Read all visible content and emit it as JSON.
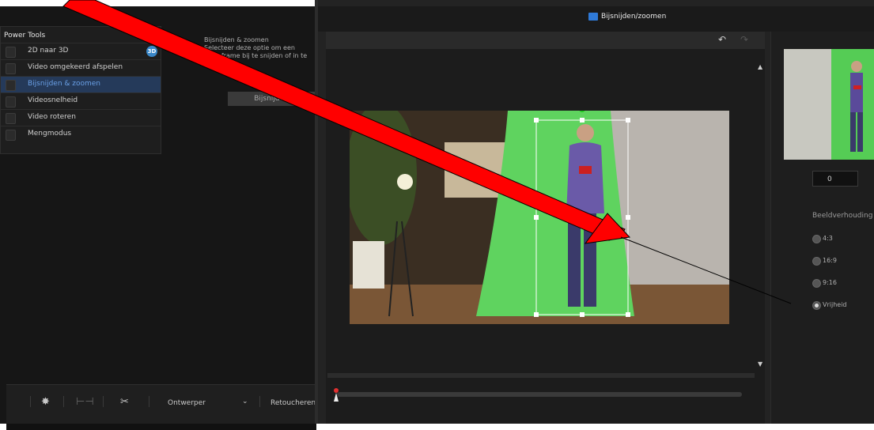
{
  "power_tools": {
    "title": "Power Tools",
    "items": [
      {
        "label": "2D naar 3D",
        "badge": "3D",
        "selected": false
      },
      {
        "label": "Video omgekeerd afspelen",
        "selected": false
      },
      {
        "label": "Bijsnijden & zoomen",
        "selected": true
      },
      {
        "label": "Videosnelheid",
        "selected": false
      },
      {
        "label": "Video roteren",
        "selected": false
      },
      {
        "label": "Mengmodus",
        "selected": false
      }
    ]
  },
  "description": {
    "title": "Bijsnijden & zoomen",
    "text": "Selecteer deze optie om een videoframe bij te snijden of in te zoomen"
  },
  "crop_button": "Bijsnijden",
  "bottom_bar": {
    "designer": "Ontwerper",
    "retouch": "Retoucheren"
  },
  "window": {
    "title": "Bijsnijden/zoomen"
  },
  "right_panel": {
    "rotation_value": "0",
    "aspect_label": "Beeldverhouding",
    "ratios": [
      {
        "label": "4:3",
        "selected": false
      },
      {
        "label": "16:9",
        "selected": false
      },
      {
        "label": "9:16",
        "selected": false
      },
      {
        "label": "Vrijheid",
        "selected": true
      }
    ]
  },
  "colors": {
    "annotation_arrow": "#ff0000",
    "selection_accent": "#3a87c8",
    "green_screen": "#5fd35f"
  },
  "icons": [
    "undo-icon",
    "redo-icon",
    "wand-icon",
    "split-icon",
    "scissors-icon",
    "chevron-down-icon",
    "playhead-icon"
  ]
}
